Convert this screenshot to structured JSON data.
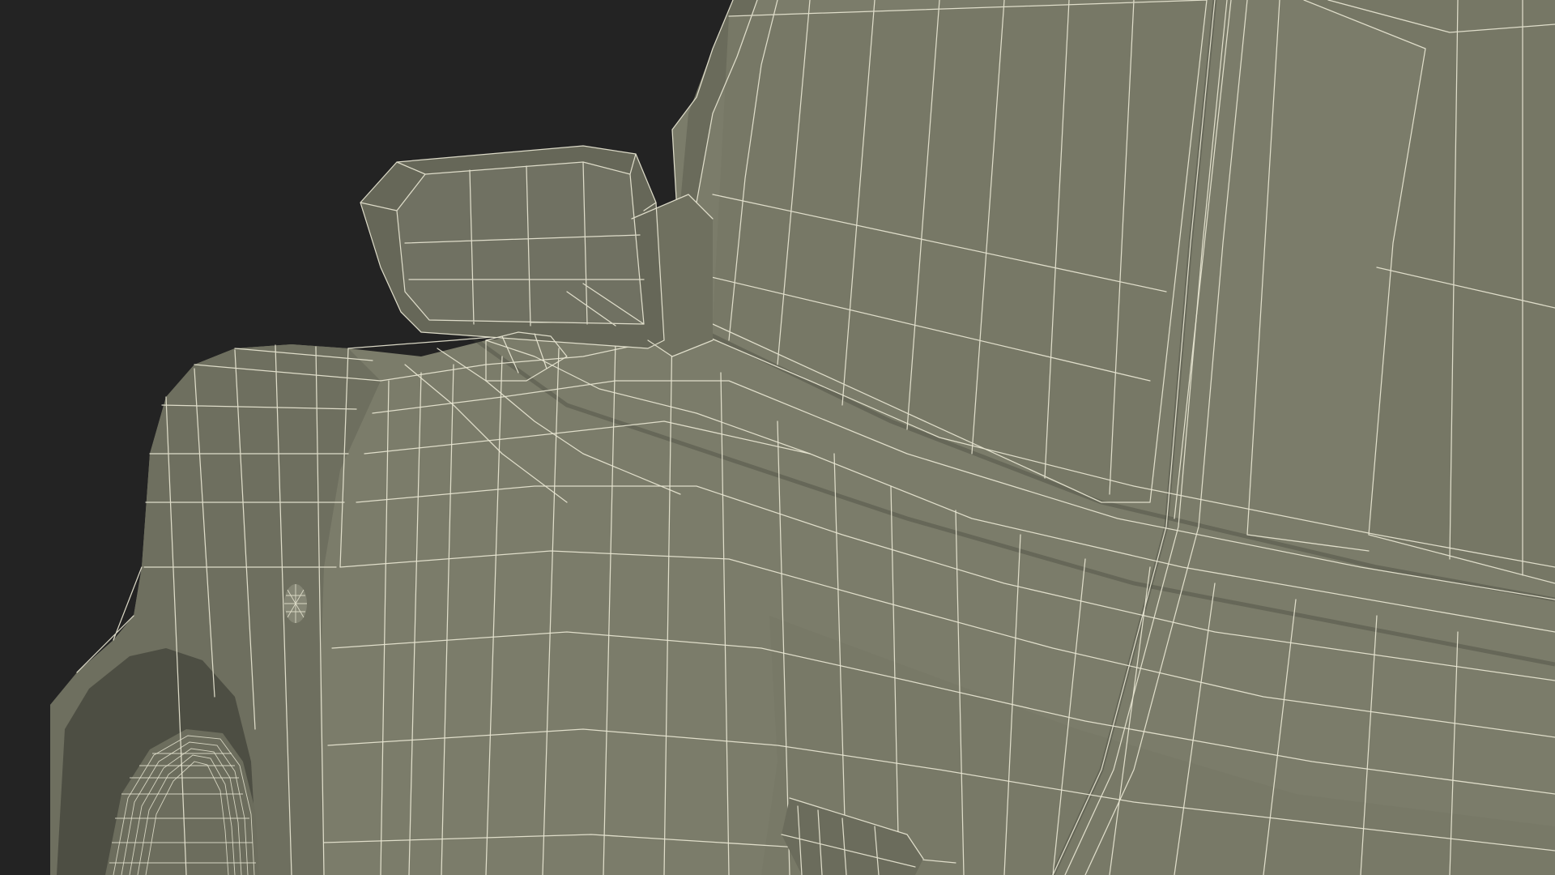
{
  "scene": {
    "subject": "wireframe-vehicle-front-quarter",
    "colors": {
      "background": "#232323",
      "body": "#7b7c6a",
      "body_shadow": "#5f6052",
      "body_dark": "#4d4e43",
      "body_light": "#878876",
      "wire": "#e8e6d2"
    },
    "parts": [
      "body-panel",
      "side-mirror",
      "fender",
      "wheel",
      "door-handle",
      "side-marker-bolt"
    ]
  }
}
